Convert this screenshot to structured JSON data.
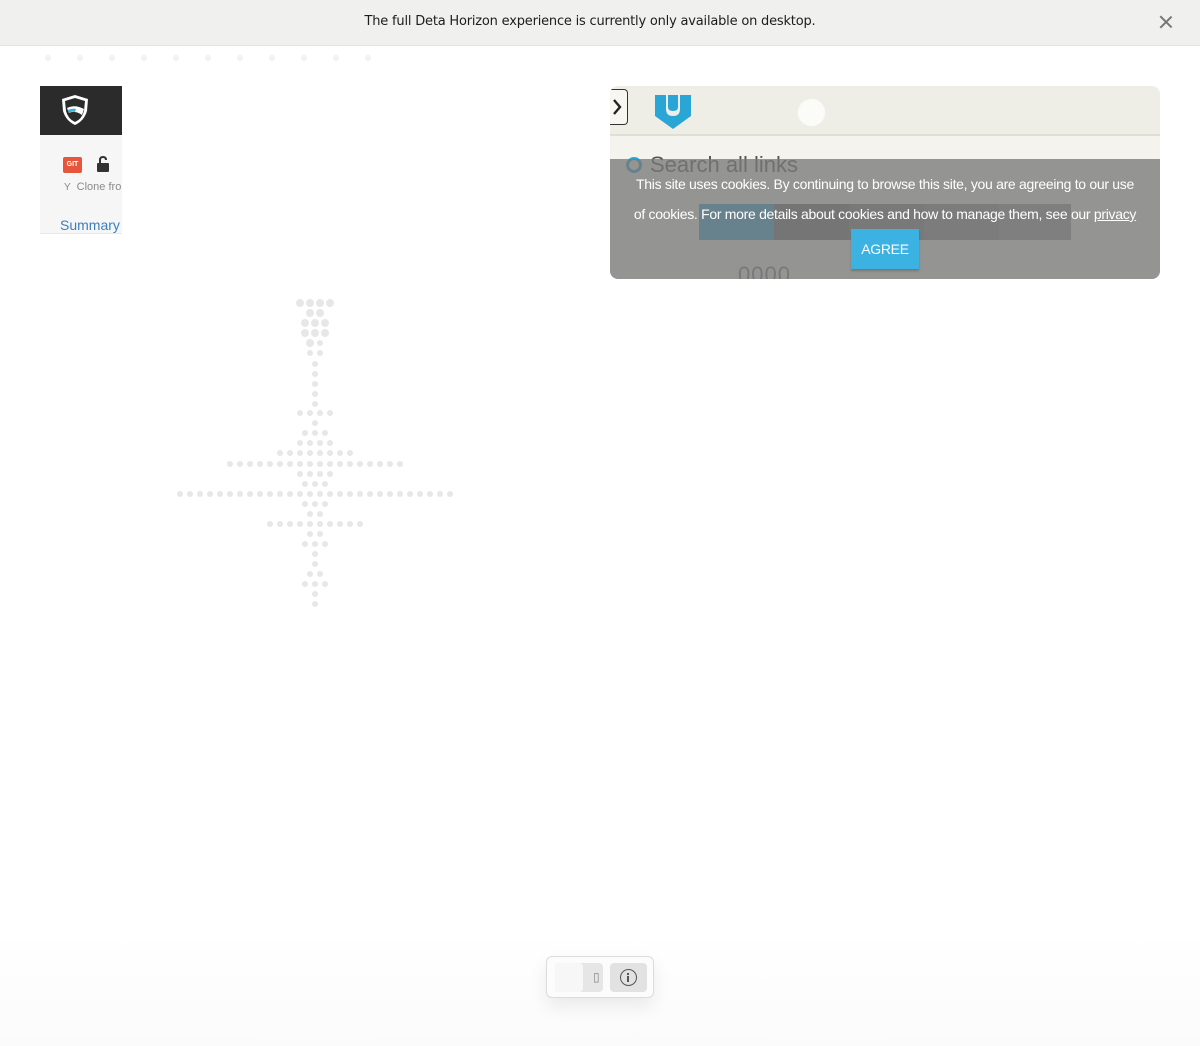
{
  "notice": {
    "message": "The full Deta Horizon experience is currently only available on desktop."
  },
  "repo_card": {
    "badge": "GIT",
    "clone_text": "Clone fro",
    "summary_link": "Summary"
  },
  "link_panel": {
    "search_placeholder": "Search all links",
    "counter": "0000"
  },
  "cookie_banner": {
    "message": "This site uses cookies. By continuing to browse this site, you are agreeing to our use of cookies. For more details about cookies and how to manage them, see our",
    "link_text": "privacy policy",
    "trailing": ".",
    "agree_label": "AGREE"
  },
  "colors": {
    "accent_blue": "#3cb2e3",
    "git_orange": "#e7553b",
    "link_blue": "#3a7fc1"
  },
  "icons": [
    "close-icon",
    "shield-icon",
    "lock-icon",
    "fork-icon",
    "chevron-right-icon",
    "brand-icon",
    "search-icon",
    "info-icon"
  ]
}
